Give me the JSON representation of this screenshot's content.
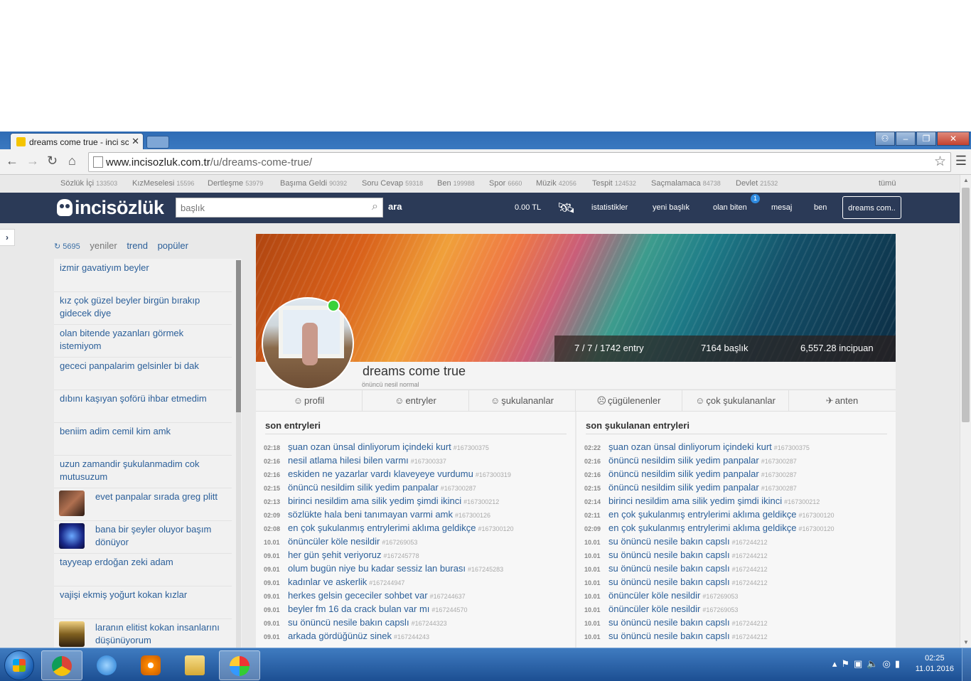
{
  "browser": {
    "tab_title": "dreams come true - inci sc",
    "url_domain": "www.incisozluk.com.tr",
    "url_path": "/u/dreams-come-true/"
  },
  "categories": [
    {
      "name": "Sözlük İçi",
      "count": "133503"
    },
    {
      "name": "KızMeselesi",
      "count": "15596"
    },
    {
      "name": "Dertleşme",
      "count": "53979"
    },
    {
      "name": "Başıma Geldi",
      "count": "90392"
    },
    {
      "name": "Soru Cevap",
      "count": "59318"
    },
    {
      "name": "Ben",
      "count": "199988"
    },
    {
      "name": "Spor",
      "count": "6660"
    },
    {
      "name": "Müzik",
      "count": "42056"
    },
    {
      "name": "Tespit",
      "count": "124532"
    },
    {
      "name": "Saçmalamaca",
      "count": "84738"
    },
    {
      "name": "Devlet",
      "count": "21532"
    }
  ],
  "categories_all": "tümü",
  "header": {
    "logo": "incisözlük",
    "search_placeholder": "başlık",
    "search_button": "ara",
    "balance": "0.00 TL",
    "nav": [
      "istatistikler",
      "yeni başlık",
      "olan biten",
      "mesaj",
      "ben"
    ],
    "notification_count": "1",
    "user_button": "dreams com.."
  },
  "left": {
    "count": "5695",
    "tabs": [
      "yeniler",
      "trend",
      "popüler"
    ],
    "topics": [
      "izmir gavatiyım beyler",
      "kız çok güzel beyler birgün bırakıp gidecek diye",
      "olan bitende yazanları görmek istemiyom",
      "gececi panpalarim gelsinler bi dak",
      "dıbını kaşıyan şoförü ihbar etmedim",
      "beniim adim cemil kim amk",
      "uzun zamandir şukulanmadim cok mutusuzum",
      "evet panpalar sırada greg plitt",
      "bana bir şeyler oluyor başım dönüyor",
      "tayyeap erdoğan zeki adam",
      "vajişi ekmiş yoğurt kokan kızlar",
      "laranın elitist kokan insanlarını düşünüyorum"
    ]
  },
  "profile": {
    "name": "dreams come true",
    "rank": "önüncü nesil normal",
    "entries": "7 / 7 / 1742 entry",
    "titles": "7164 başlık",
    "points": "6,557.28 incipuan",
    "tabs": [
      "profil",
      "entryler",
      "şukulananlar",
      "çügülenenler",
      "çok şukulananlar",
      "anten"
    ]
  },
  "son_entryleri": {
    "title": "son entryleri",
    "items": [
      {
        "time": "02:18",
        "title": "şuan ozan ünsal dinliyorum içindeki kurt",
        "id": "#167300375"
      },
      {
        "time": "02:16",
        "title": "nesil atlama hilesi bilen varmı",
        "id": "#167300337"
      },
      {
        "time": "02:16",
        "title": "eskiden ne yazarlar vardı klaveyeye vurdumu",
        "id": "#167300319"
      },
      {
        "time": "02:15",
        "title": "önüncü nesildim silik yedim panpalar",
        "id": "#167300287"
      },
      {
        "time": "02:13",
        "title": "birinci nesildim ama silik yedim şimdi ikinci",
        "id": "#167300212"
      },
      {
        "time": "02:09",
        "title": "sözlükte hala beni tanımayan varmi amk",
        "id": "#167300126"
      },
      {
        "time": "02:08",
        "title": "en çok şukulanmış entrylerimi aklıma geldikçe",
        "id": "#167300120"
      },
      {
        "time": "10.01",
        "title": "önüncüler köle nesildir",
        "id": "#167269053"
      },
      {
        "time": "09.01",
        "title": "her gün şehit veriyoruz",
        "id": "#167245778"
      },
      {
        "time": "09.01",
        "title": "olum bugün niye bu kadar sessiz lan burası",
        "id": "#167245283"
      },
      {
        "time": "09.01",
        "title": "kadınlar ve askerlik",
        "id": "#167244947"
      },
      {
        "time": "09.01",
        "title": "herkes gelsin gececiler sohbet var",
        "id": "#167244637"
      },
      {
        "time": "09.01",
        "title": "beyler fm 16 da crack bulan var mı",
        "id": "#167244570"
      },
      {
        "time": "09.01",
        "title": "su önüncü nesile bakın capslı",
        "id": "#167244323"
      },
      {
        "time": "09.01",
        "title": "arkada gördüğünüz sinek",
        "id": "#167244243"
      }
    ]
  },
  "son_sukulanan": {
    "title": "son şukulanan entryleri",
    "items": [
      {
        "time": "02:22",
        "title": "şuan ozan ünsal dinliyorum içindeki kurt",
        "id": "#167300375"
      },
      {
        "time": "02:16",
        "title": "önüncü nesildim silik yedim panpalar",
        "id": "#167300287"
      },
      {
        "time": "02:16",
        "title": "önüncü nesildim silik yedim panpalar",
        "id": "#167300287"
      },
      {
        "time": "02:15",
        "title": "önüncü nesildim silik yedim panpalar",
        "id": "#167300287"
      },
      {
        "time": "02:14",
        "title": "birinci nesildim ama silik yedim şimdi ikinci",
        "id": "#167300212"
      },
      {
        "time": "02:11",
        "title": "en çok şukulanmış entrylerimi aklıma geldikçe",
        "id": "#167300120"
      },
      {
        "time": "02:09",
        "title": "en çok şukulanmış entrylerimi aklıma geldikçe",
        "id": "#167300120"
      },
      {
        "time": "10.01",
        "title": "su önüncü nesile bakın capslı",
        "id": "#167244212"
      },
      {
        "time": "10.01",
        "title": "su önüncü nesile bakın capslı",
        "id": "#167244212"
      },
      {
        "time": "10.01",
        "title": "su önüncü nesile bakın capslı",
        "id": "#167244212"
      },
      {
        "time": "10.01",
        "title": "su önüncü nesile bakın capslı",
        "id": "#167244212"
      },
      {
        "time": "10.01",
        "title": "önüncüler köle nesildir",
        "id": "#167269053"
      },
      {
        "time": "10.01",
        "title": "önüncüler köle nesildir",
        "id": "#167269053"
      },
      {
        "time": "10.01",
        "title": "su önüncü nesile bakın capslı",
        "id": "#167244212"
      },
      {
        "time": "10.01",
        "title": "su önüncü nesile bakın capslı",
        "id": "#167244212"
      }
    ]
  },
  "taskbar": {
    "time": "02:25",
    "date": "11.01.2016"
  }
}
